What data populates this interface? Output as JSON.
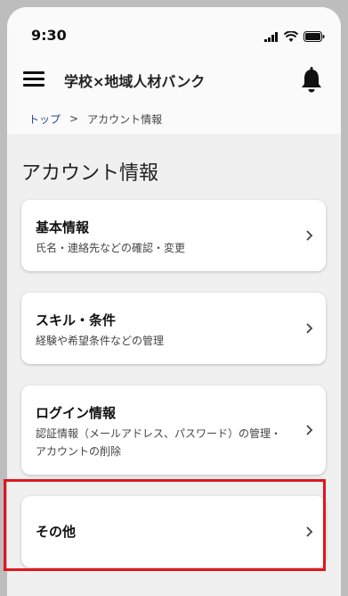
{
  "status": {
    "time": "9:30"
  },
  "appbar": {
    "title": "学校×地域人材バンク"
  },
  "breadcrumb": {
    "home": "トップ",
    "separator": ">",
    "current": "アカウント情報"
  },
  "page": {
    "title": "アカウント情報"
  },
  "cards": [
    {
      "title": "基本情報",
      "subtitle": "氏名・連絡先などの確認・変更"
    },
    {
      "title": "スキル・条件",
      "subtitle": "経験や希望条件などの管理"
    },
    {
      "title": "ログイン情報",
      "subtitle": "認証情報（メールアドレス、パスワード）の管理・アカウントの削除"
    },
    {
      "title": "その他",
      "subtitle": ""
    }
  ],
  "icons": [
    "menu-icon",
    "bell-icon",
    "chevron-right-icon",
    "signal-icon",
    "wifi-icon",
    "battery-icon"
  ],
  "colors": {
    "highlight": "#e0161e",
    "link": "#2b4a8a"
  }
}
